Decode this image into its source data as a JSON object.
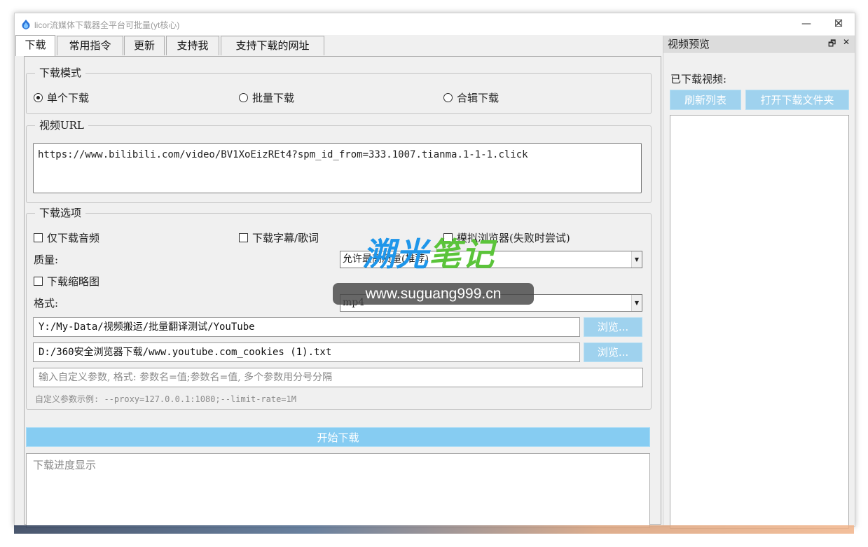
{
  "window": {
    "title": "licor流媒体下载器全平台可批量(yt核心)",
    "minimize_glyph": "—",
    "maximize_glyph": "☐",
    "close_glyph": "✕"
  },
  "tabs": [
    {
      "label": "下载",
      "active": true
    },
    {
      "label": "常用指令",
      "active": false
    },
    {
      "label": "更新",
      "active": false
    },
    {
      "label": "支持我",
      "active": false
    },
    {
      "label": "支持下载的网址",
      "active": false
    }
  ],
  "download_mode": {
    "title": "下载模式",
    "options": [
      {
        "label": "单个下载",
        "selected": true
      },
      {
        "label": "批量下载",
        "selected": false
      },
      {
        "label": "合辑下载",
        "selected": false
      }
    ]
  },
  "video_url": {
    "title": "视频URL",
    "value": "https://www.bilibili.com/video/BV1XoEizREt4?spm_id_from=333.1007.tianma.1-1-1.click"
  },
  "options": {
    "title": "下载选项",
    "audio_only": "仅下载音频",
    "subtitles": "下载字幕/歌词",
    "simulate_browser": "模拟浏览器(失败时尝试)",
    "quality_label": "质量:",
    "quality_value": "允许最高质量(推荐)",
    "thumbnail": "下载缩略图",
    "format_label": "格式:",
    "format_value": "mp4",
    "output_dir": "Y:/My-Data/视频搬运/批量翻译测试/YouTube",
    "cookies_file": "D:/360安全浏览器下载/www.youtube.com_cookies (1).txt",
    "browse_label": "浏览...",
    "custom_params_placeholder": "输入自定义参数, 格式: 参数名=值;参数名=值, 多个参数用分号分隔",
    "custom_params_hint": "自定义参数示例: --proxy=127.0.0.1:1080;--limit-rate=1M"
  },
  "start_button": "开始下载",
  "progress_placeholder": "下载进度显示",
  "preview": {
    "title": "视频预览",
    "float_glyph": "🗗",
    "close_glyph": "✕",
    "downloaded_label": "已下载视频:",
    "refresh_button": "刷新列表",
    "open_folder_button": "打开下载文件夹"
  },
  "watermark": {
    "part1": "溯光",
    "part2": "笔记",
    "url": "www.suguang999.cn"
  },
  "colors": {
    "accent_button": "#86ccf2",
    "browse_button": "#9fd2ee",
    "watermark_blue": "#1e96ea",
    "watermark_green": "#5bc43a"
  }
}
